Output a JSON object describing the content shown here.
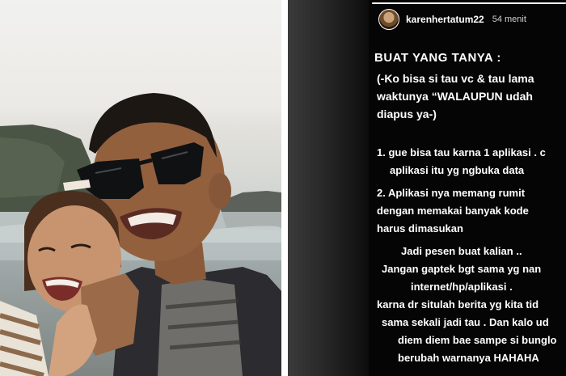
{
  "photo": {
    "alt": "",
    "colors": {
      "sky": "#eceae6",
      "rock": "#4f5a4c",
      "sea": "#a9b4b3"
    }
  },
  "story": {
    "progress": 1.0,
    "user": {
      "username": "karenhertatum22",
      "timestamp": "54 menit",
      "avatar_icon": "profile-avatar-icon"
    },
    "heading": "BUAT YANG TANYA :",
    "intro_lines": [
      "(-Ko bisa si tau vc & tau lama",
      "waktunya “WALAUPUN udah",
      "diapus ya-)"
    ],
    "item1_lines": [
      "1. gue bisa tau karna 1 aplikasi . c",
      "aplikasi itu yg ngbuka data"
    ],
    "item2_lines": [
      "2. Aplikasi nya memang rumit",
      "dengan memakai banyak kode",
      "harus dimasukan"
    ],
    "closing_lines": [
      "Jadi pesen buat kalian ..",
      "Jangan gaptek bgt sama yg nan",
      "internet/hp/aplikasi .",
      "karna dr situlah berita yg kita tid",
      "sama sekali jadi tau . Dan kalo ud",
      "diem diem bae sampe si bunglo",
      "berubah warnanya HAHAHA"
    ],
    "colors": {
      "background": "#050505",
      "text": "#ffffff"
    }
  }
}
